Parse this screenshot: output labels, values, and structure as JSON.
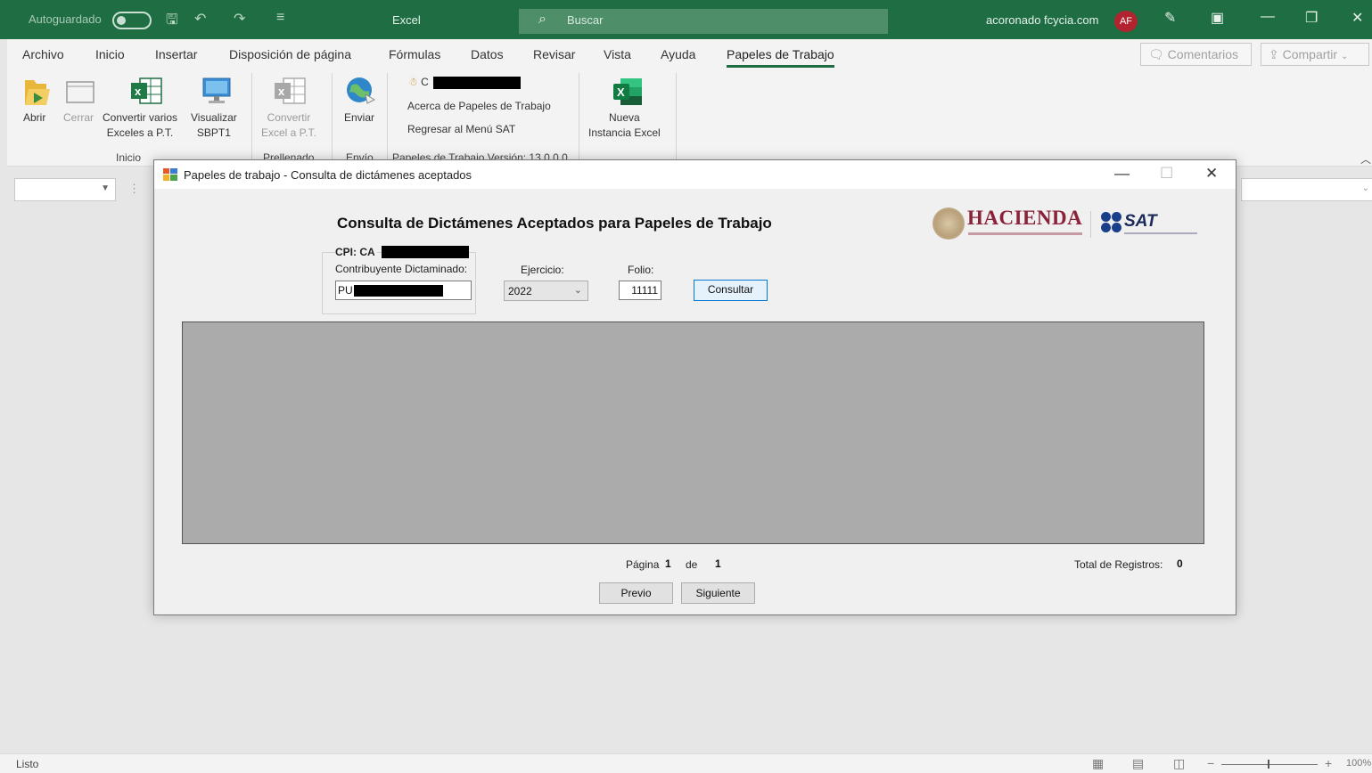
{
  "titlebar": {
    "autosave": "Autoguardado",
    "app_name": "Excel",
    "search_placeholder": "Buscar",
    "user": "acoronado fcycia.com",
    "avatar": "AF"
  },
  "menu": {
    "tabs": [
      "Archivo",
      "Inicio",
      "Insertar",
      "Disposición de página",
      "Fórmulas",
      "Datos",
      "Revisar",
      "Vista",
      "Ayuda",
      "Papeles de Trabajo"
    ],
    "active_tab": "Papeles de Trabajo",
    "comments": "Comentarios",
    "share": "Compartir"
  },
  "ribbon": {
    "abrir": "Abrir",
    "cerrar": "Cerrar",
    "convertir_varios_1": "Convertir varios",
    "convertir_varios_2": "Exceles a P.T.",
    "visualizar_1": "Visualizar",
    "visualizar_2": "SBPT1",
    "convertir_1": "Convertir",
    "convertir_2": "Excel a P.T.",
    "enviar": "Enviar",
    "user_prefix": "C",
    "acerca": "Acerca de Papeles de Trabajo",
    "regresar": "Regresar al Menú SAT",
    "version": "Papeles de Trabajo Versión: 13.0.0.0",
    "nueva_1": "Nueva",
    "nueva_2": "Instancia Excel",
    "groups": {
      "inicio": "Inicio",
      "prellenado": "Prellenado",
      "envio": "Envío"
    }
  },
  "status": {
    "ready": "Listo",
    "zoom": "100%"
  },
  "dialog": {
    "title": "Papeles de trabajo - Consulta de dictámenes aceptados",
    "heading": "Consulta de Dictámenes Aceptados para Papeles de Trabajo",
    "cpi_label": "CPI: CA",
    "contribuyente_label": "Contribuyente Dictaminado:",
    "contribuyente_value": "PU",
    "ejercicio_label": "Ejercicio:",
    "ejercicio_value": "2022",
    "folio_label": "Folio:",
    "folio_value": "11111",
    "consultar": "Consultar",
    "pagina_label": "Página",
    "pagina_value": "1",
    "de_label": "de",
    "de_value": "1",
    "total_label": "Total de Registros:",
    "total_value": "0",
    "previo": "Previo",
    "siguiente": "Siguiente",
    "logo_hacienda": "HACIENDA",
    "logo_sat": "SAT"
  },
  "colors": {
    "excel_green": "#1f6e43",
    "avatar_red": "#b1242f",
    "hacienda": "#8a2238",
    "sat_blue": "#1a3f8a",
    "grid_gray": "#ababab"
  }
}
